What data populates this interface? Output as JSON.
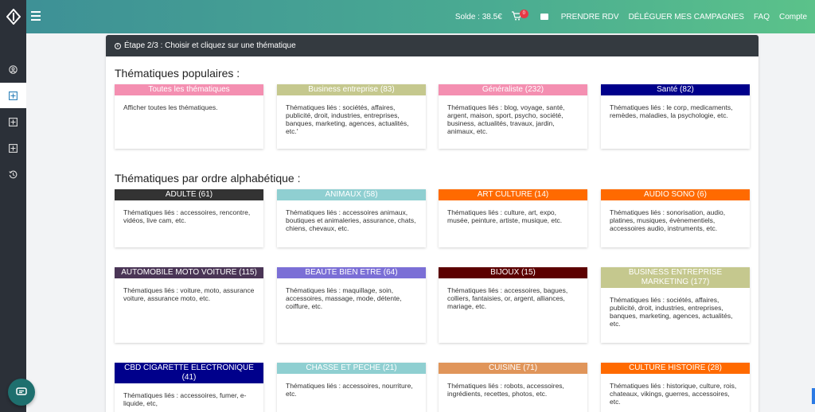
{
  "topbar": {
    "balance": "Solde : 38.5€",
    "cart_count": "0",
    "nav": [
      "PRENDRE RDV",
      "DÉLÉGUER MES CAMPAGNES",
      "FAQ",
      "Compte"
    ]
  },
  "sidebar": {
    "icons": [
      "user-circle-icon",
      "plus-square-icon",
      "plus-square-icon",
      "plus-square-icon",
      "history-icon"
    ]
  },
  "panel": {
    "header": "Étape 2/3 : Choisir et cliquez sur une thématique"
  },
  "popular": {
    "title": "Thématiques populaires :",
    "cards": [
      {
        "label": "Toutes les thématiques",
        "desc": "Afficher toutes les thématiques.",
        "color": "#f48fb1"
      },
      {
        "label": "Business entreprise (83)",
        "desc": "Thématiques liés : sociétés, affaires, publicité, droit, industries, entreprises, banques, marketing, agences, actualités, etc.'",
        "color": "#c5c88e"
      },
      {
        "label": "Généraliste (232)",
        "desc": "Thématiques liés : blog, voyage, santé, argent, maison, sport, psycho, société, business, actualités, travaux, jardin, animaux, etc.",
        "color": "#f48fb1"
      },
      {
        "label": "Santé (82)",
        "desc": "Thématiques liés : le corp, medicaments, remèdes, maladies, la psychologie, etc.",
        "color": "#00008b"
      }
    ]
  },
  "alpha": {
    "title": "Thématiques par ordre alphabétique :",
    "cards": [
      {
        "label": "ADULTE (61)",
        "desc": "Thématiques liés : accessoires, rencontre, vidéos, live cam, etc.",
        "color": "#333333"
      },
      {
        "label": "ANIMAUX (58)",
        "desc": "Thématiques liés : accessoires animaux, boutiques et animaleries, assurance, chats, chiens, chevaux, etc.",
        "color": "#8fcfd1"
      },
      {
        "label": "ART CULTURE (14)",
        "desc": "Thématiques liés : culture, art, expo, musée, peinture, artiste, musique, etc.",
        "color": "#ff6a00"
      },
      {
        "label": "AUDIO SONO (6)",
        "desc": "Thématiques liés : sonorisation, audio, platines, musiques, évènementiels, accessoires audio, instruments, etc.",
        "color": "#ff6a00"
      },
      {
        "label": "AUTOMOBILE MOTO VOITURE (115)",
        "desc": "Thématiques liés : voiture, moto, assurance voiture, assurance moto, etc.",
        "color": "#4a3556"
      },
      {
        "label": "BEAUTE BIEN ETRE (64)",
        "desc": "Thématiques liés : maquillage, soin, accessoires, massage, mode, détente, coiffure, etc.",
        "color": "#7b6fd6"
      },
      {
        "label": "BIJOUX (15)",
        "desc": "Thématiques liés : accessoires, bagues, colliers, fantaisies, or, argent, alliances, mariage, etc.",
        "color": "#5c0000"
      },
      {
        "label": "BUSINESS ENTREPRISE MARKETING (177)",
        "desc": "Thématiques liés : sociétés, affaires, publicité, droit, industries, entreprises, banques, marketing, agences, actualités, etc.",
        "color": "#c5c88e"
      },
      {
        "label": "CBD CIGARETTE ELECTRONIQUE (41)",
        "desc": "Thématiques liés : accessoires, fumer, e-liquide, etc,",
        "color": "#00008b"
      },
      {
        "label": "CHASSE ET PECHE (21)",
        "desc": "Thématiques liés : accessoires, nourriture, etc.",
        "color": "#8fcfd1"
      },
      {
        "label": "CUISINE (71)",
        "desc": "Thématiques liés : robots, accessoires, ingrédients, recettes, photos, etc.",
        "color": "#e0955a"
      },
      {
        "label": "CULTURE HISTOIRE (28)",
        "desc": "Thématiques liés : historique, culture, rois, chateaux, vikings, guerres, accessoires, etc.",
        "color": "#ff6a00"
      }
    ]
  }
}
